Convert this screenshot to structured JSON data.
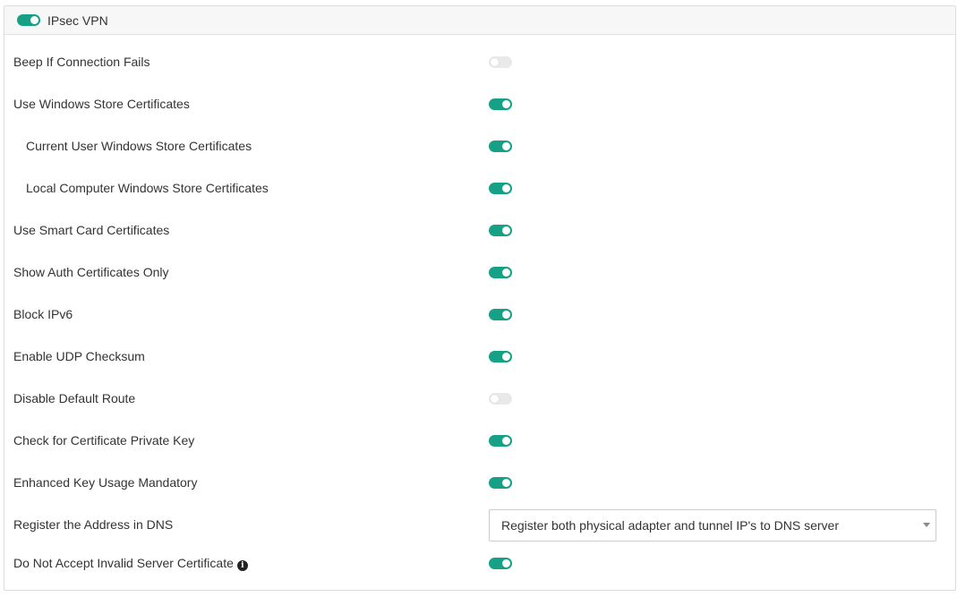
{
  "panel": {
    "title": "IPsec VPN",
    "enabled": true
  },
  "settings": [
    {
      "label": "Beep If Connection Fails",
      "enabled": false,
      "indent": false
    },
    {
      "label": "Use Windows Store Certificates",
      "enabled": true,
      "indent": false
    },
    {
      "label": "Current User Windows Store Certificates",
      "enabled": true,
      "indent": true
    },
    {
      "label": "Local Computer Windows Store Certificates",
      "enabled": true,
      "indent": true
    },
    {
      "label": "Use Smart Card Certificates",
      "enabled": true,
      "indent": false
    },
    {
      "label": "Show Auth Certificates Only",
      "enabled": true,
      "indent": false
    },
    {
      "label": "Block IPv6",
      "enabled": true,
      "indent": false
    },
    {
      "label": "Enable UDP Checksum",
      "enabled": true,
      "indent": false
    },
    {
      "label": "Disable Default Route",
      "enabled": false,
      "indent": false
    },
    {
      "label": "Check for Certificate Private Key",
      "enabled": true,
      "indent": false
    },
    {
      "label": "Enhanced Key Usage Mandatory",
      "enabled": true,
      "indent": false
    }
  ],
  "register_dns": {
    "label": "Register the Address in DNS",
    "selected": "Register both physical adapter and tunnel IP's to DNS server"
  },
  "invalid_cert": {
    "label": "Do Not Accept Invalid Server Certificate",
    "enabled": true,
    "icon": "info-icon",
    "icon_glyph": "i"
  },
  "colors": {
    "toggle_on": "#16a085",
    "toggle_off": "#e9e9e9",
    "header_bg": "#f7f7f7",
    "text": "#333333"
  }
}
